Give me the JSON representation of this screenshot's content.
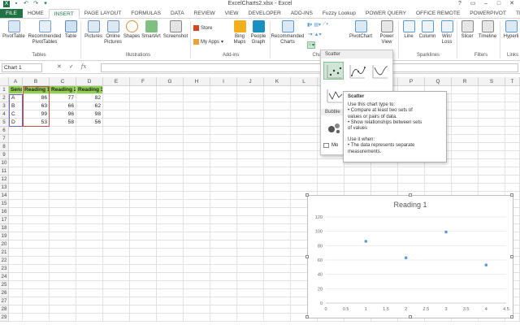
{
  "window": {
    "title": "ExcelCharts2.xlsx - Excel",
    "controls": [
      "?",
      "▭",
      "–",
      "□",
      "✕"
    ]
  },
  "tabs": [
    {
      "label": "FILE",
      "kind": "file"
    },
    {
      "label": "HOME",
      "kind": "normal"
    },
    {
      "label": "INSERT",
      "kind": "active"
    },
    {
      "label": "PAGE LAYOUT",
      "kind": "normal"
    },
    {
      "label": "FORMULAS",
      "kind": "normal"
    },
    {
      "label": "DATA",
      "kind": "normal"
    },
    {
      "label": "REVIEW",
      "kind": "normal"
    },
    {
      "label": "VIEW",
      "kind": "normal"
    },
    {
      "label": "DEVELOPER",
      "kind": "normal"
    },
    {
      "label": "ADD-INS",
      "kind": "normal"
    },
    {
      "label": "Fuzzy Lookup",
      "kind": "normal"
    },
    {
      "label": "POWER QUERY",
      "kind": "normal"
    },
    {
      "label": "OFFICE REMOTE",
      "kind": "normal"
    },
    {
      "label": "POWERPIVOT",
      "kind": "normal"
    },
    {
      "label": "TEAM",
      "kind": "normal"
    }
  ],
  "ribbon": {
    "buttons": {
      "pivottable": "PivotTable",
      "recommended_pivottables": "Recommended PivotTables",
      "table": "Table",
      "pictures": "Pictures",
      "online_pictures": "Online Pictures",
      "shapes": "Shapes",
      "smartart": "SmartArt",
      "screenshot": "Screenshot",
      "store": "Store",
      "my_apps": "My Apps",
      "bing_maps": "Bing Maps",
      "people_graph": "People Graph",
      "recommended_charts": "Recommended Charts",
      "pivotchart": "PivotChart",
      "power_view": "Power View",
      "line": "Line",
      "column": "Column",
      "win_loss": "Win/ Loss",
      "slicer": "Slicer",
      "timeline": "Timeline",
      "hyperlink": "Hyperli"
    },
    "groups": {
      "tables": "Tables",
      "illustrations": "Illustrations",
      "addins": "Add-ins",
      "charts": "Cha",
      "reports": "Reports",
      "sparklines": "Sparklines",
      "filters": "Filters",
      "links": "Links"
    }
  },
  "formula_bar": {
    "name_box": "Chart 1",
    "cancel": "✕",
    "enter": "✓",
    "fx": "fx",
    "formula": ""
  },
  "grid": {
    "columns": [
      "A",
      "B",
      "C",
      "D",
      "E",
      "F",
      "G",
      "H",
      "I",
      "J",
      "K",
      "L",
      "M",
      "N",
      "O",
      "P",
      "Q",
      "R",
      "S",
      "T"
    ],
    "rows": [
      "1",
      "2",
      "3",
      "4",
      "5",
      "6",
      "7",
      "8",
      "9",
      "10",
      "11",
      "12",
      "13",
      "14",
      "15",
      "16",
      "17",
      "18",
      "19",
      "20",
      "21",
      "22",
      "23",
      "24",
      "25",
      "26",
      "27",
      "28",
      "29"
    ],
    "table": {
      "headers": [
        "Sensor",
        "Reading 1",
        "Reading 2",
        "Reading 3"
      ],
      "rows": [
        [
          "A",
          "86",
          "77",
          "82"
        ],
        [
          "B",
          "63",
          "66",
          "62"
        ],
        [
          "C",
          "99",
          "96",
          "98"
        ],
        [
          "D",
          "53",
          "58",
          "56"
        ]
      ]
    }
  },
  "scatter_dropdown": {
    "header": "Scatter",
    "sub_header": "Bubble",
    "more_label": "Mo"
  },
  "tooltip": {
    "title": "Scatter",
    "lines": [
      "Use this chart type to:",
      "• Compare at least two sets of",
      "values or pairs of data.",
      "• Show relationships between sets",
      "of values",
      "",
      "Use it when:",
      "• The data represents separate",
      "measurements."
    ]
  },
  "chart_data": {
    "type": "scatter",
    "title": "Reading 1",
    "x_ticks": [
      "0",
      "0.5",
      "1",
      "1.5",
      "2",
      "2.5",
      "3",
      "3.5",
      "4",
      "4.5"
    ],
    "y_ticks": [
      "0",
      "20",
      "40",
      "60",
      "80",
      "100",
      "120"
    ],
    "xlim": [
      0,
      4.5
    ],
    "ylim": [
      0,
      120
    ],
    "grid": "horizontal",
    "series": [
      {
        "x": [
          1,
          2,
          3,
          4
        ],
        "y": [
          86,
          63,
          99,
          53
        ],
        "color": "#5b9bd5"
      }
    ]
  },
  "colors": {
    "excel_green": "#217346",
    "header_fill": "#92d050",
    "accent_blue": "#5b9bd5"
  }
}
